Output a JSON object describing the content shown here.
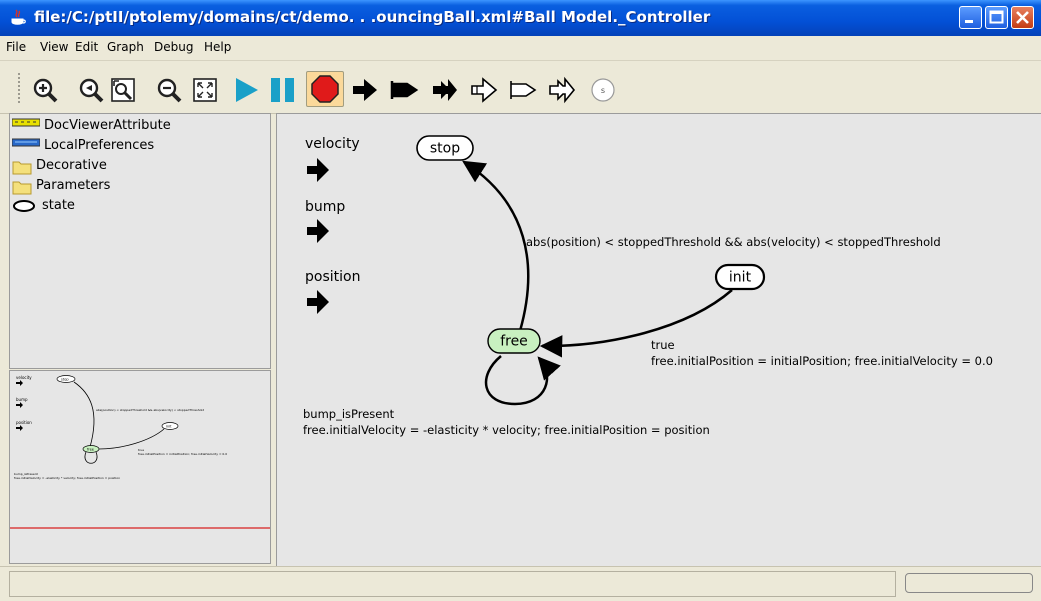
{
  "window": {
    "title": "file:/C:/ptII/ptolemy/domains/ct/demo. . .ouncingBall.xml#Ball Model._Controller"
  },
  "menu": {
    "items": [
      "File",
      "View",
      "Edit",
      "Graph",
      "Debug",
      "Help"
    ]
  },
  "toolbar": {
    "icons": [
      "zoom-in-icon",
      "zoom-reset-icon",
      "zoom-fit-icon",
      "zoom-out-icon",
      "fullscreen-icon",
      "run-icon",
      "pause-icon",
      "stop-icon",
      "port-input-icon",
      "port-output-icon",
      "port-inout-icon",
      "multiport-input-icon",
      "multiport-output-icon",
      "multiport-inout-icon",
      "state-icon"
    ],
    "selected": "stop-icon",
    "colors": {
      "run": "#1aa0c8",
      "pause": "#1aa0c8",
      "stop": "#e01a1a"
    }
  },
  "library": {
    "items": [
      {
        "label": "DocViewerAttribute",
        "icon": "doc-viewer-icon"
      },
      {
        "label": "LocalPreferences",
        "icon": "preferences-icon"
      },
      {
        "label": "Decorative",
        "icon": "folder-icon"
      },
      {
        "label": "Parameters",
        "icon": "folder-icon"
      },
      {
        "label": "state",
        "icon": "state-icon"
      }
    ]
  },
  "canvas": {
    "ports": [
      {
        "label": "velocity"
      },
      {
        "label": "bump"
      },
      {
        "label": "position"
      }
    ],
    "states": {
      "stop": "stop",
      "free": "free",
      "init": "init"
    },
    "transitions": {
      "free_to_stop": "abs(position) < stoppedThreshold && abs(velocity) < stoppedThreshold",
      "init_to_free_guard": "true",
      "init_to_free_action": "free.initialPosition = initialPosition; free.initialVelocity = 0.0",
      "free_self_guard": "bump_isPresent",
      "free_self_action": "free.initialVelocity = -elasticity * velocity; free.initialPosition = position"
    },
    "colors": {
      "free_fill": "#c8f0c0",
      "state_fill": "#ffffff",
      "overview_line": "#d82020"
    }
  },
  "statusbar": {
    "message": ""
  }
}
